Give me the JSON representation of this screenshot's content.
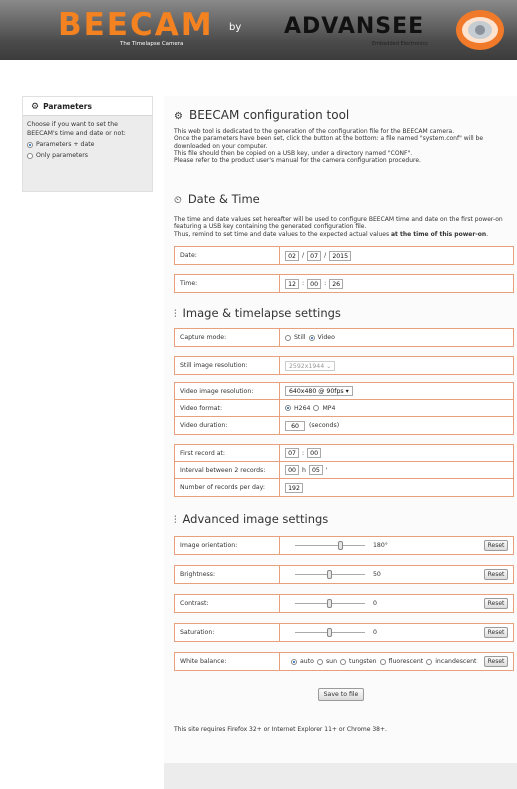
{
  "header": {
    "brand_name": "BEECAM",
    "brand_tagline": "The Timelapse Camera",
    "by": "by",
    "partner_name": "ADVANSEE",
    "partner_tagline": "Embedded Electronics"
  },
  "sidebar": {
    "title": "Parameters",
    "description": "Choose if you want to set the BEECAM's time and date or not:",
    "options": [
      "Parameters + date",
      "Only parameters"
    ],
    "selected": "Parameters + date"
  },
  "intro": {
    "title": "BEECAM configuration tool",
    "lines": [
      "This web tool is dedicated to the generation of the configuration file for the BEECAM camera.",
      "Once the parameters have been set, click the button at the bottom: a file named \"system.conf\" will be downloaded on your computer.",
      "This file should then be copied on a USB key, under a directory named \"CONF\".",
      "Please refer to the product user's manual for the camera configuration procedure."
    ]
  },
  "datetime": {
    "title": "Date & Time",
    "line1": "The time and date values set hereafter will be used to configure BEECAM time and date on the first power-on featuring a USB key containing the generated configuration file.",
    "line2": "Thus, remind to set time and date values to the expected actual values ",
    "line2_bold": "at the time of this power-on",
    "line2_end": ".",
    "date_label": "Date:",
    "date_day": "02",
    "date_month": "07",
    "date_year": "2015",
    "time_label": "Time:",
    "time_hour": "12",
    "time_min": "00",
    "time_sec": "26"
  },
  "image": {
    "title": "Image & timelapse settings",
    "capture_label": "Capture mode:",
    "capture_still": "Still",
    "capture_video": "Video",
    "capture_selected": "Video",
    "still_res_label": "Still image resolution:",
    "still_res_value": "2592x1944",
    "video_res_label": "Video image resolution:",
    "video_res_value": "640x480 @ 90fps",
    "video_format_label": "Video format:",
    "format_h264": "H264",
    "format_mp4": "MP4",
    "format_selected": "H264",
    "video_duration_label": "Video duration:",
    "video_duration_value": "60",
    "video_duration_unit": "(seconds)",
    "first_record_label": "First record at:",
    "first_record_h": "07",
    "first_record_m": "00",
    "interval_label": "Interval between 2 records:",
    "interval_h": "00",
    "interval_h_unit": "h",
    "interval_m": "05",
    "interval_m_unit": "'",
    "records_per_day_label": "Number of records per day:",
    "records_per_day_value": "192"
  },
  "advanced": {
    "title": "Advanced image settings",
    "orientation_label": "Image orientation:",
    "orientation_value": "180°",
    "orientation_level": 0.65,
    "brightness_label": "Brightness:",
    "brightness_value": "50",
    "brightness_level": 0.5,
    "contrast_label": "Contrast:",
    "contrast_value": "0",
    "contrast_level": 0.5,
    "saturation_label": "Saturation:",
    "saturation_value": "0",
    "saturation_level": 0.5,
    "white_balance_label": "White balance:",
    "wb_options": [
      "auto",
      "sun",
      "tungsten",
      "fluorescent",
      "incandescent"
    ],
    "wb_selected": "auto",
    "reset_label": "Reset"
  },
  "save_label": "Save to file",
  "compat_note": "This site requires Firefox 32+ or Internet Explorer 11+ or Chrome 38+."
}
